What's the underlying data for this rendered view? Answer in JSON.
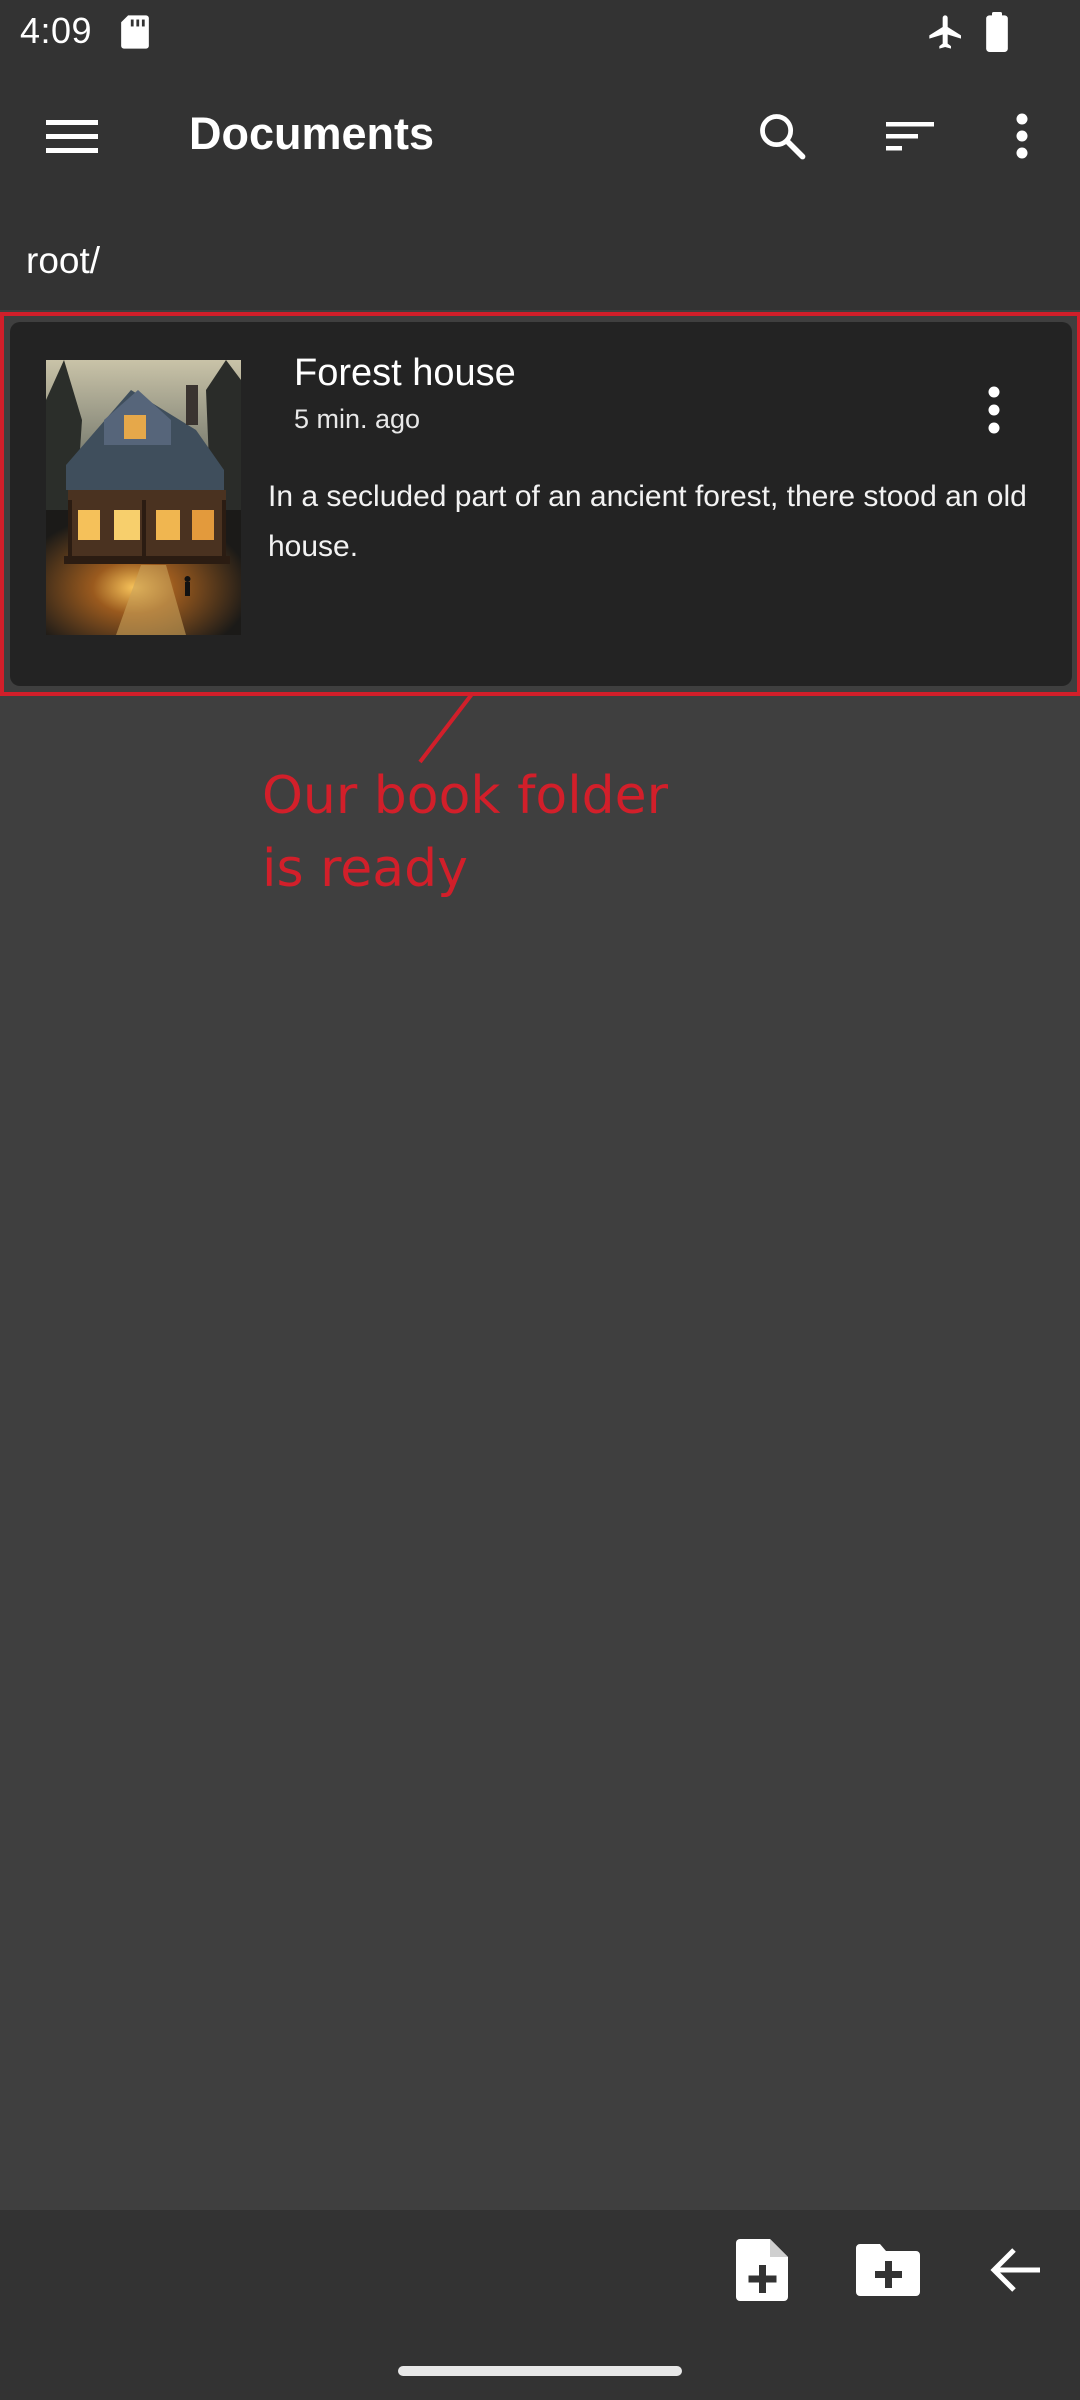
{
  "status_bar": {
    "time": "4:09",
    "icons": [
      "sd-card-icon",
      "airplane-mode-icon",
      "battery-icon"
    ]
  },
  "app_bar": {
    "title": "Documents",
    "icons": [
      "hamburger-menu-icon",
      "search-icon",
      "sort-icon",
      "more-vert-icon"
    ]
  },
  "breadcrumb": {
    "path": "root/"
  },
  "documents": [
    {
      "title": "Forest house",
      "time": "5 min. ago",
      "description": "In a secluded part of an ancient forest, there stood an old house.",
      "thumbnail_icon": "forest-house-cover-image"
    }
  ],
  "annotation": {
    "text_line1": "Our book folder",
    "text_line2": "is ready",
    "color": "#d21f2a"
  },
  "bottom_bar": {
    "icons": [
      "new-document-icon",
      "new-folder-icon",
      "back-arrow-icon"
    ]
  },
  "colors": {
    "background": "#3f3f3f",
    "bars": "#333333",
    "card": "#232323",
    "highlight": "#d21f2a"
  }
}
